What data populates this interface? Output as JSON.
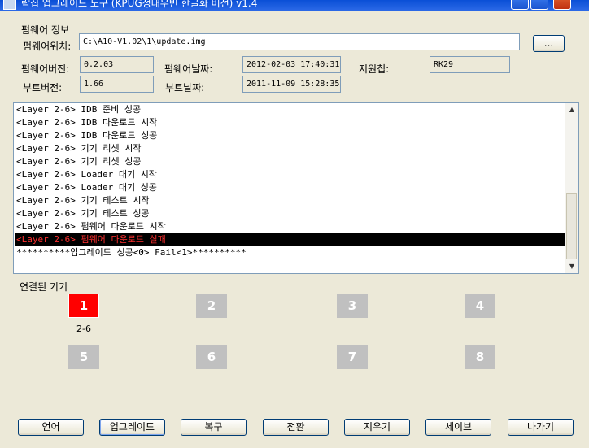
{
  "window": {
    "title": "락칩 업그레이드 도구 (KPUG정대우빈 한글화 버전) v1.4"
  },
  "firmware": {
    "section_label": "펌웨어 정보",
    "path_label": "펌웨어위치:",
    "path_value": "C:\\A10-V1.02\\1\\update.img",
    "browse_label": "...",
    "fw_version_label": "펌웨어버전:",
    "fw_version_value": "0.2.03",
    "fw_date_label": "펌웨어날짜:",
    "fw_date_value": "2012-02-03 17:40:31",
    "chip_label": "지원칩:",
    "chip_value": "RK29",
    "boot_version_label": "부트버전:",
    "boot_version_value": "1.66",
    "boot_date_label": "부트날짜:",
    "boot_date_value": "2011-11-09 15:28:35"
  },
  "log": {
    "lines": [
      {
        "text": "<Layer 2-6> IDB 준비 성공",
        "error": false
      },
      {
        "text": "<Layer 2-6> IDB 다운로드 시작",
        "error": false
      },
      {
        "text": "<Layer 2-6> IDB 다운로드 성공",
        "error": false
      },
      {
        "text": "<Layer 2-6> 기기 리셋 시작",
        "error": false
      },
      {
        "text": "<Layer 2-6> 기기 리셋 성공",
        "error": false
      },
      {
        "text": "<Layer 2-6> Loader 대기 시작",
        "error": false
      },
      {
        "text": "<Layer 2-6> Loader 대기 성공",
        "error": false
      },
      {
        "text": "<Layer 2-6> 기기 테스트 시작",
        "error": false
      },
      {
        "text": "<Layer 2-6> 기기 테스트 성공",
        "error": false
      },
      {
        "text": "<Layer 2-6> 펌웨어 다운로드 시작",
        "error": false
      },
      {
        "text": "<Layer 2-6> 펌웨어 다운로드 실패",
        "error": true
      },
      {
        "text": "**********업그레이드 성공<0> Fail<1>**********",
        "error": false
      }
    ]
  },
  "devices": {
    "label": "연결된 기기",
    "slots": [
      {
        "number": "1",
        "active": true,
        "port": "2-6"
      },
      {
        "number": "2",
        "active": false,
        "port": ""
      },
      {
        "number": "3",
        "active": false,
        "port": ""
      },
      {
        "number": "4",
        "active": false,
        "port": ""
      },
      {
        "number": "5",
        "active": false,
        "port": ""
      },
      {
        "number": "6",
        "active": false,
        "port": ""
      },
      {
        "number": "7",
        "active": false,
        "port": ""
      },
      {
        "number": "8",
        "active": false,
        "port": ""
      }
    ],
    "active_color": "#ff0000",
    "inactive_color": "#c0c0c0"
  },
  "buttons": {
    "language": "언어",
    "upgrade": "업그레이드",
    "restore": "복구",
    "switch": "전환",
    "erase": "지우기",
    "save": "세이브",
    "exit": "나가기"
  }
}
